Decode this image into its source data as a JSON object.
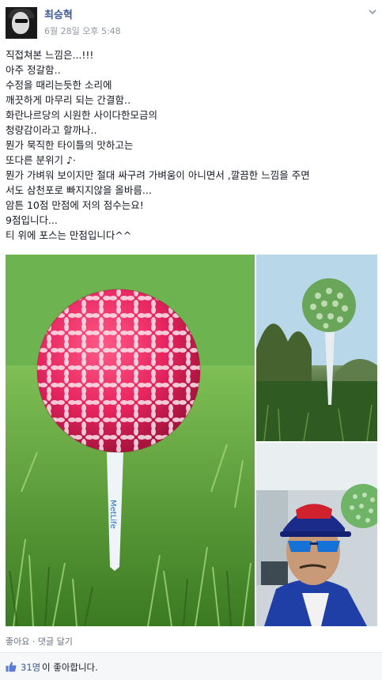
{
  "author": {
    "name": "최승혁"
  },
  "timestamp": "6월 28일 오후 5:48",
  "post_lines": [
    "직접쳐본 느낌은...!!!",
    "아주 정갈함‥",
    "수정을 때리는듯한 소리에",
    "깨끗하게 마무리 되는 간결함‥",
    "화란나르당의 시원한 사이다한모금의",
    "청량감이라고 할까나..",
    "뭔가 묵직한 타이틀의 맛하고는",
    "또다른 분위기 ♪·",
    "뭔가 가벼워 보이지만 절대 싸구려 가벼움이 아니면서 ,깔끔한 느낌을 주면",
    "서도 삼천포로 빠지지않을 올바름...",
    "암튼 10점 만점에 저의 점수는요!",
    "9점입니다...",
    "티 위에 포스는 만점입니다^^"
  ],
  "photos": {
    "tee_brand": "MetLife"
  },
  "actions": {
    "like": "좋아요",
    "separator": " · ",
    "comment": "댓글 달기"
  },
  "likes": {
    "count": "31명",
    "text": "이 좋아합니다."
  },
  "colors": {
    "link": "#3b5998",
    "meta": "#9197a3",
    "ball_pink": "#e8245e"
  },
  "icons": [
    "chevron-down-icon",
    "thumbs-up-icon"
  ]
}
